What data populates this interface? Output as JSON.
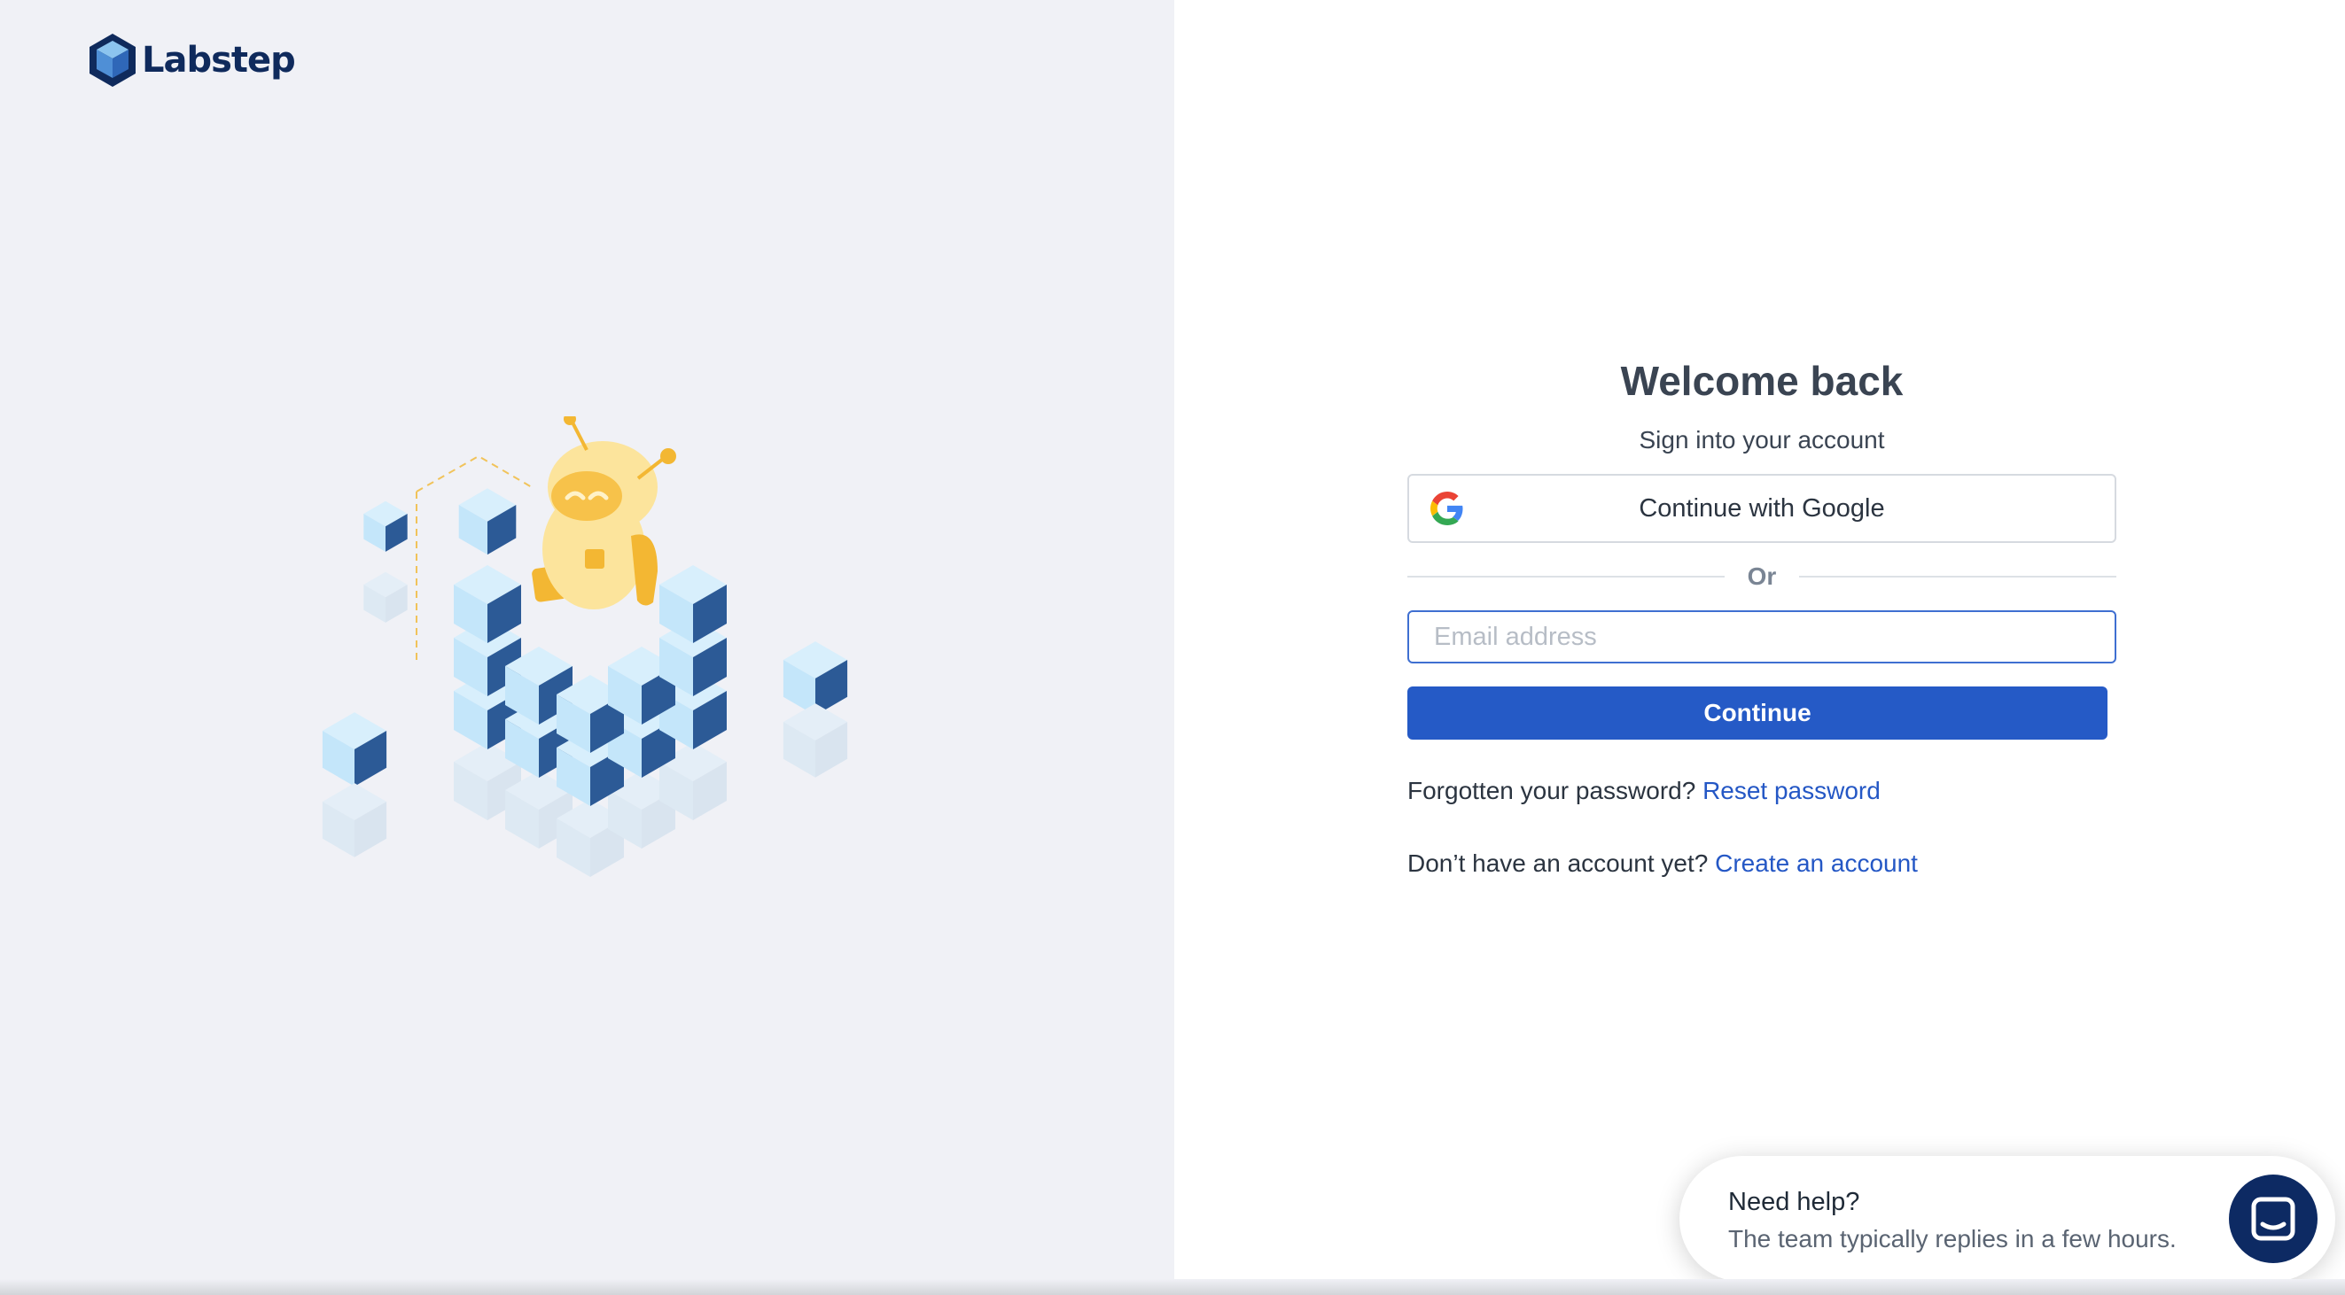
{
  "brand": {
    "name": "Labstep",
    "logo_icon": "hexagon-cube-logo"
  },
  "login": {
    "title": "Welcome back",
    "subtitle": "Sign into your account",
    "google_button": "Continue with Google",
    "divider": "Or",
    "email_placeholder": "Email address",
    "email_value": "",
    "continue_button": "Continue",
    "forgot_text": "Forgotten your password?",
    "reset_link": "Reset password",
    "signup_text": "Don’t have an account yet?",
    "signup_link": "Create an account"
  },
  "help_widget": {
    "title": "Need help?",
    "subtitle": "The team typically replies in a few hours.",
    "launcher_icon": "chat-icon"
  },
  "colors": {
    "accent": "#255ac6",
    "link": "#2457c5",
    "left_bg": "#f0f1f6",
    "navy": "#0d2a63"
  }
}
